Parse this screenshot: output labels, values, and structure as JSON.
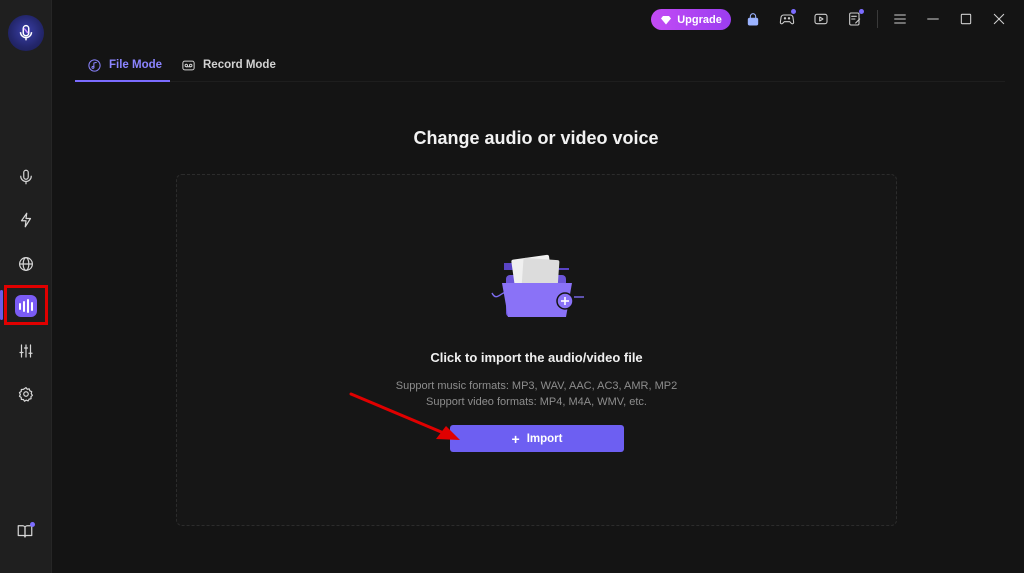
{
  "topbar": {
    "upgrade_label": "Upgrade"
  },
  "tabs": [
    {
      "label": "File Mode",
      "active": true
    },
    {
      "label": "Record Mode",
      "active": false
    }
  ],
  "main": {
    "title": "Change audio or video voice",
    "drop_title": "Click to import the audio/video file",
    "music_formats": "Support music formats: MP3, WAV, AAC, AC3, AMR, MP2",
    "video_formats": "Support video formats: MP4, M4A, WMV, etc.",
    "import_label": "Import"
  },
  "sidebar": {
    "items": [
      "microphone-icon",
      "lightning-icon",
      "globe-icon",
      "voice-changer-icon",
      "sliders-icon",
      "settings-icon"
    ],
    "bottom": "book-icon"
  },
  "colors": {
    "accent": "#6d5ff2",
    "upgrade": "#b845f3",
    "highlight_frame": "#e00000"
  }
}
